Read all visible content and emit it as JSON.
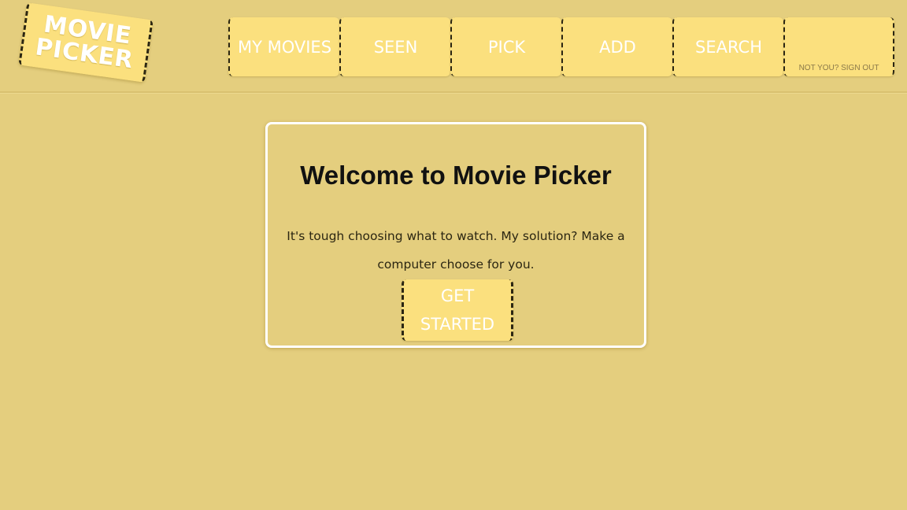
{
  "logo": {
    "line1": "MOVIE",
    "line2": "PICKER"
  },
  "nav": {
    "items": [
      {
        "label": "MY MOVIES"
      },
      {
        "label": "SEEN"
      },
      {
        "label": "PICK"
      },
      {
        "label": "ADD"
      },
      {
        "label": "SEARCH"
      },
      {
        "label": "NOT YOU? SIGN OUT"
      }
    ]
  },
  "welcome": {
    "title": "Welcome to Movie Picker",
    "description": "It's tough choosing what to watch. My solution? Make a computer choose for you.",
    "button_label": "GET STARTED"
  },
  "colors": {
    "background": "#e4ce7e",
    "ticket": "#fbe07e",
    "ticket_text": "#ffffff",
    "card_border": "#ffffff",
    "dash": "#2b2612"
  }
}
